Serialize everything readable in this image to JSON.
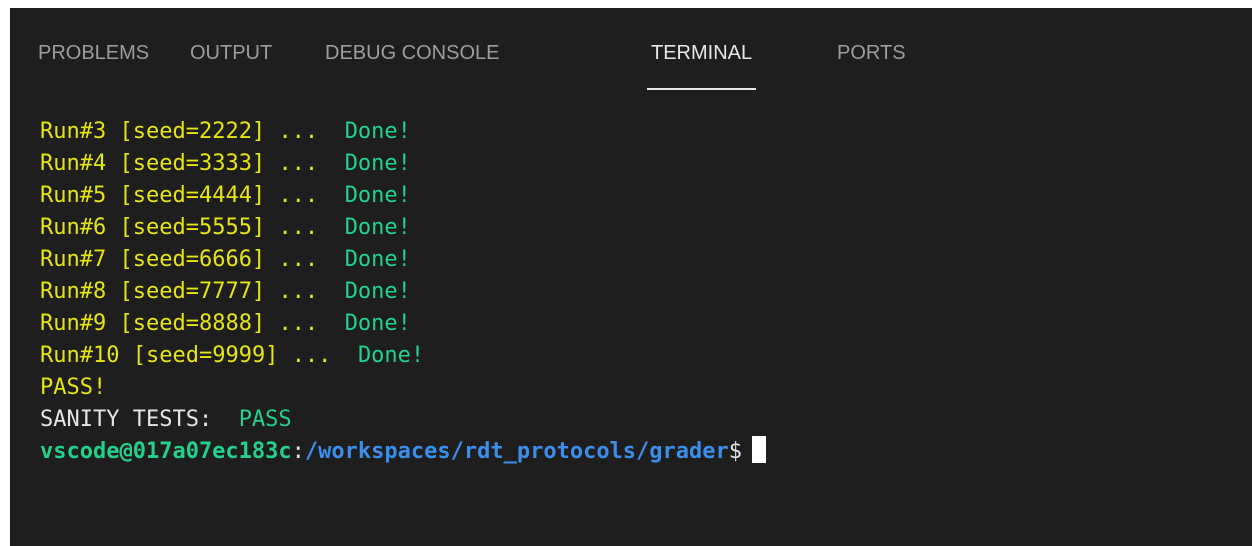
{
  "tabs": [
    {
      "label": "PROBLEMS",
      "active": false
    },
    {
      "label": "OUTPUT",
      "active": false
    },
    {
      "label": "DEBUG CONSOLE",
      "active": false
    },
    {
      "label": "TERMINAL",
      "active": true
    },
    {
      "label": "PORTS",
      "active": false
    }
  ],
  "terminal": {
    "runs": [
      {
        "run": "Run#3",
        "seed": "[seed=2222]",
        "dots": "...",
        "status": "Done!"
      },
      {
        "run": "Run#4",
        "seed": "[seed=3333]",
        "dots": "...",
        "status": "Done!"
      },
      {
        "run": "Run#5",
        "seed": "[seed=4444]",
        "dots": "...",
        "status": "Done!"
      },
      {
        "run": "Run#6",
        "seed": "[seed=5555]",
        "dots": "...",
        "status": "Done!"
      },
      {
        "run": "Run#7",
        "seed": "[seed=6666]",
        "dots": "...",
        "status": "Done!"
      },
      {
        "run": "Run#8",
        "seed": "[seed=7777]",
        "dots": "...",
        "status": "Done!"
      },
      {
        "run": "Run#9",
        "seed": "[seed=8888]",
        "dots": "...",
        "status": "Done!"
      },
      {
        "run": "Run#10",
        "seed": "[seed=9999]",
        "dots": "...",
        "status": "Done!"
      }
    ],
    "pass_line": "PASS!",
    "sanity_label": "SANITY TESTS:",
    "sanity_result": "PASS",
    "prompt_user": "vscode@017a07ec183c",
    "prompt_sep": ":",
    "prompt_path": "/workspaces/rdt_protocols/grader",
    "prompt_symbol": "$"
  },
  "colors": {
    "background": "#1e1e1e",
    "yellow": "#e5e510",
    "green": "#23d18b",
    "blue": "#3b8eea",
    "active_tab": "#e7e7e7",
    "inactive_tab": "#9d9d9d"
  }
}
